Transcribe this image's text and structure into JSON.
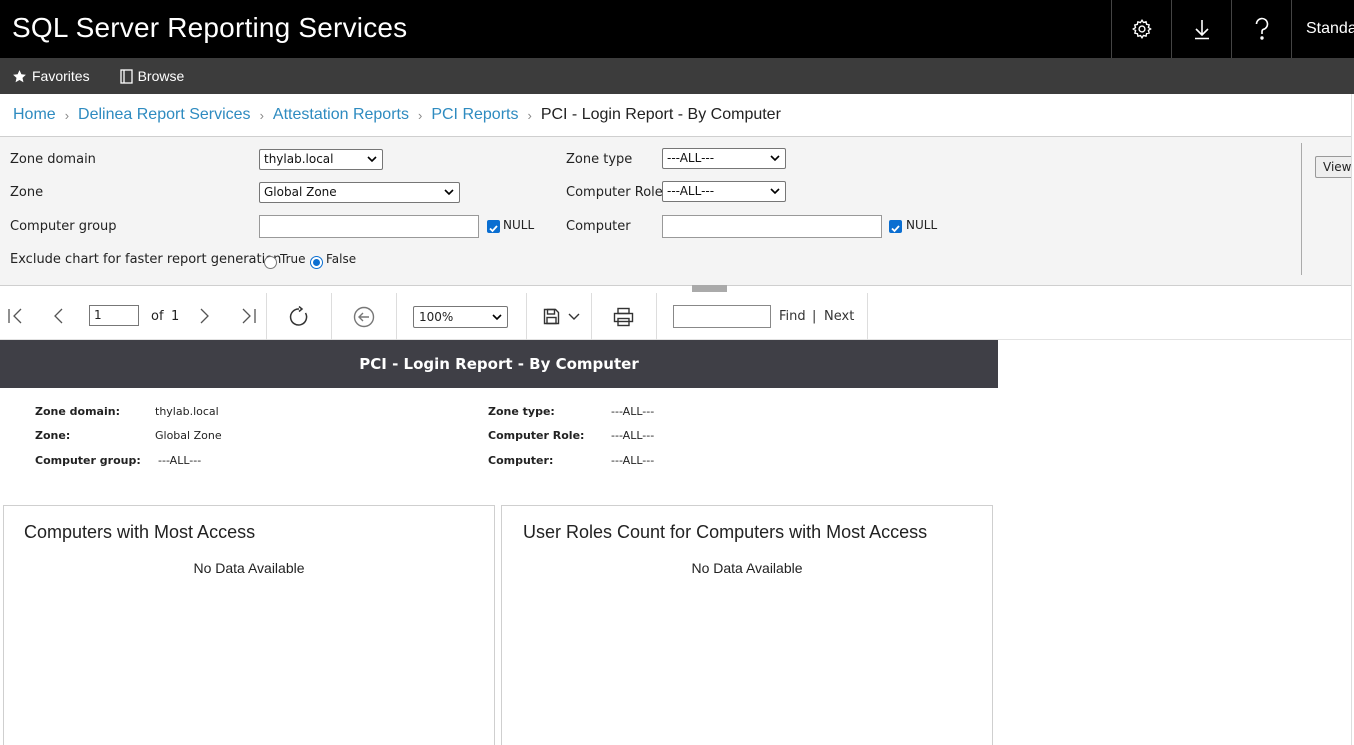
{
  "app": {
    "title": "SQL Server Reporting Services",
    "user": "Standa"
  },
  "topbar": {
    "icons": [
      "gear-icon",
      "download-icon",
      "help-icon"
    ]
  },
  "subnav": {
    "favorites": "Favorites",
    "browse": "Browse"
  },
  "breadcrumb": {
    "items": [
      "Home",
      "Delinea Report Services",
      "Attestation Reports",
      "PCI Reports"
    ],
    "current": "PCI - Login Report - By Computer"
  },
  "params": {
    "zone_domain_label": "Zone domain",
    "zone_domain_value": "thylab.local",
    "zone_label": "Zone",
    "zone_value": "Global Zone",
    "computer_group_label": "Computer group",
    "computer_group_value": "",
    "computer_group_null": "NULL",
    "exclude_label": "Exclude chart for faster report generation",
    "true_label": "True",
    "false_label": "False",
    "zone_type_label": "Zone type",
    "zone_type_value": "---ALL---",
    "computer_role_label": "Computer Role",
    "computer_role_value": "---ALL---",
    "computer_label": "Computer",
    "computer_value": "",
    "computer_null": "NULL",
    "view_button": "View"
  },
  "toolbar": {
    "page": "1",
    "of": "of",
    "total_pages": "1",
    "zoom": "100%",
    "find": "Find",
    "separator": "|",
    "next": "Next"
  },
  "report": {
    "title": "PCI - Login Report - By Computer",
    "left": [
      {
        "label": "Zone domain:",
        "value": "thylab.local"
      },
      {
        "label": "Zone:",
        "value": "Global Zone"
      },
      {
        "label": "Computer group:",
        "value": "---ALL---"
      }
    ],
    "right": [
      {
        "label": "Zone type:",
        "value": "---ALL---"
      },
      {
        "label": "Computer Role:",
        "value": "---ALL---"
      },
      {
        "label": "Computer:",
        "value": "---ALL---"
      }
    ],
    "charts": [
      {
        "title": "Computers with Most Access",
        "message": "No Data Available"
      },
      {
        "title": "User Roles Count for Computers with Most Access",
        "message": "No Data Available"
      }
    ]
  }
}
